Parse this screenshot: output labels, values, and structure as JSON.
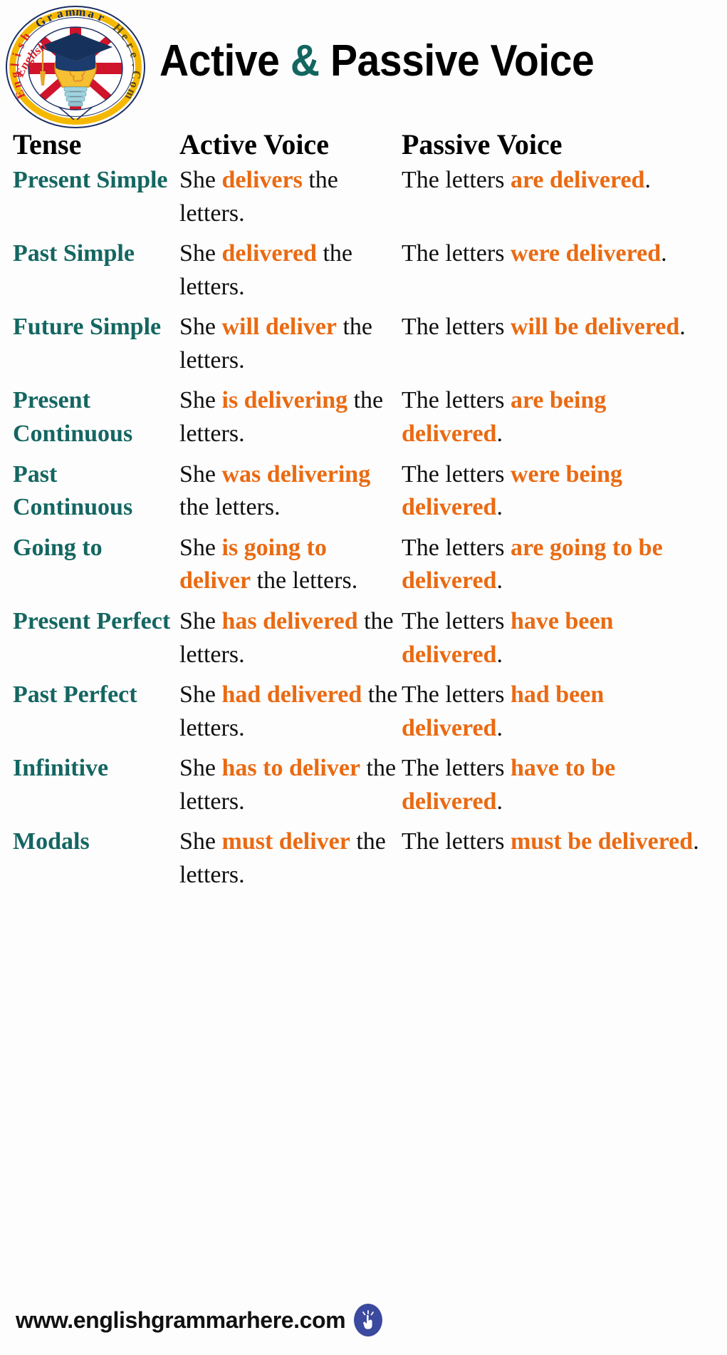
{
  "header": {
    "logo": {
      "name": "english-grammar-here-logo",
      "arc_text_left": "English Grammar",
      "arc_text_right": "Here.Com",
      "arc_text_full": "English Grammar Here.Com",
      "colors": {
        "ring_gold": "#f5b800",
        "ring_navy": "#1c2f63",
        "text_red": "#d8232a",
        "text_navy": "#1c2f63",
        "text_olive": "#6b5a12"
      }
    },
    "title_part_1": "Active ",
    "title_amp": "&",
    "title_part_2": " Passive Voice",
    "title_full": "Active & Passive Voice"
  },
  "colors": {
    "tense_teal": "#146661",
    "highlight_orange": "#ea6a12",
    "body_black": "#101010",
    "footer_badge_blue": "#3b4a9e"
  },
  "table": {
    "columns": [
      "Tense",
      "Active Voice",
      "Passive Voice"
    ],
    "rows": [
      {
        "tense": "Present Simple",
        "active_parts": [
          {
            "t": "She ",
            "hl": false
          },
          {
            "t": "delivers",
            "hl": true
          },
          {
            "t": " the letters.",
            "hl": false
          }
        ],
        "active_text": "She delivers the letters.",
        "passive_parts": [
          {
            "t": "The letters ",
            "hl": false
          },
          {
            "t": "are delivered",
            "hl": true
          },
          {
            "t": ".",
            "hl": false
          }
        ],
        "passive_text": "The letters are delivered."
      },
      {
        "tense": "Past Simple",
        "active_parts": [
          {
            "t": "She ",
            "hl": false
          },
          {
            "t": "delivered",
            "hl": true
          },
          {
            "t": " the letters.",
            "hl": false
          }
        ],
        "active_text": "She delivered the letters.",
        "passive_parts": [
          {
            "t": "The letters ",
            "hl": false
          },
          {
            "t": "were delivered",
            "hl": true
          },
          {
            "t": ".",
            "hl": false
          }
        ],
        "passive_text": "The letters were delivered."
      },
      {
        "tense": "Future Simple",
        "active_parts": [
          {
            "t": "She ",
            "hl": false
          },
          {
            "t": "will deliver",
            "hl": true
          },
          {
            "t": " the letters.",
            "hl": false
          }
        ],
        "active_text": "She will deliver the letters.",
        "passive_parts": [
          {
            "t": "The letters ",
            "hl": false
          },
          {
            "t": "will be delivered",
            "hl": true
          },
          {
            "t": ".",
            "hl": false
          }
        ],
        "passive_text": "The letters will be delivered."
      },
      {
        "tense": "Present Continuous",
        "active_parts": [
          {
            "t": "She ",
            "hl": false
          },
          {
            "t": "is delivering",
            "hl": true
          },
          {
            "t": " the letters.",
            "hl": false
          }
        ],
        "active_text": "She is delivering the letters.",
        "passive_parts": [
          {
            "t": "The letters ",
            "hl": false
          },
          {
            "t": "are being delivered",
            "hl": true
          },
          {
            "t": ".",
            "hl": false
          }
        ],
        "passive_text": "The letters are being delivered."
      },
      {
        "tense": "Past Continuous",
        "active_parts": [
          {
            "t": "She ",
            "hl": false
          },
          {
            "t": "was delivering",
            "hl": true
          },
          {
            "t": " the letters.",
            "hl": false
          }
        ],
        "active_text": "She was delivering the letters.",
        "passive_parts": [
          {
            "t": "The letters ",
            "hl": false
          },
          {
            "t": "were being delivered",
            "hl": true
          },
          {
            "t": ".",
            "hl": false
          }
        ],
        "passive_text": "The letters were being delivered."
      },
      {
        "tense": "Going to",
        "active_parts": [
          {
            "t": "She ",
            "hl": false
          },
          {
            "t": "is going to deliver",
            "hl": true
          },
          {
            "t": " the letters.",
            "hl": false
          }
        ],
        "active_text": "She is going to deliver the letters.",
        "passive_parts": [
          {
            "t": "The letters ",
            "hl": false
          },
          {
            "t": "are going to be delivered",
            "hl": true
          },
          {
            "t": ".",
            "hl": false
          }
        ],
        "passive_text": "The letters are going to be delivered."
      },
      {
        "tense": "Present Perfect",
        "active_parts": [
          {
            "t": "She ",
            "hl": false
          },
          {
            "t": "has delivered",
            "hl": true
          },
          {
            "t": " the letters.",
            "hl": false
          }
        ],
        "active_text": "She has delivered the letters.",
        "passive_parts": [
          {
            "t": "The letters ",
            "hl": false
          },
          {
            "t": "have been delivered",
            "hl": true
          },
          {
            "t": ".",
            "hl": false
          }
        ],
        "passive_text": "The letters have been delivered."
      },
      {
        "tense": "Past Perfect",
        "active_parts": [
          {
            "t": "She ",
            "hl": false
          },
          {
            "t": "had delivered",
            "hl": true
          },
          {
            "t": " the letters.",
            "hl": false
          }
        ],
        "active_text": "She had delivered the letters.",
        "passive_parts": [
          {
            "t": "The letters ",
            "hl": false
          },
          {
            "t": "had been delivered",
            "hl": true
          },
          {
            "t": ".",
            "hl": false
          }
        ],
        "passive_text": "The letters had been delivered."
      },
      {
        "tense": "Infinitive",
        "active_parts": [
          {
            "t": "She ",
            "hl": false
          },
          {
            "t": "has to deliver",
            "hl": true
          },
          {
            "t": " the letters.",
            "hl": false
          }
        ],
        "active_text": "She has to deliver the letters.",
        "passive_parts": [
          {
            "t": "The letters ",
            "hl": false
          },
          {
            "t": "have to be delivered",
            "hl": true
          },
          {
            "t": ".",
            "hl": false
          }
        ],
        "passive_text": "The letters have to be delivered."
      },
      {
        "tense": "Modals",
        "active_parts": [
          {
            "t": "She ",
            "hl": false
          },
          {
            "t": "must deliver",
            "hl": true
          },
          {
            "t": " the letters.",
            "hl": false
          }
        ],
        "active_text": "She must deliver the letters.",
        "passive_parts": [
          {
            "t": "The letters ",
            "hl": false
          },
          {
            "t": "must be delivered",
            "hl": true
          },
          {
            "t": ".",
            "hl": false
          }
        ],
        "passive_text": "The letters must be delivered."
      }
    ]
  },
  "footer": {
    "url": "www.englishgrammarhere.com",
    "icon": "click-hand-icon"
  }
}
